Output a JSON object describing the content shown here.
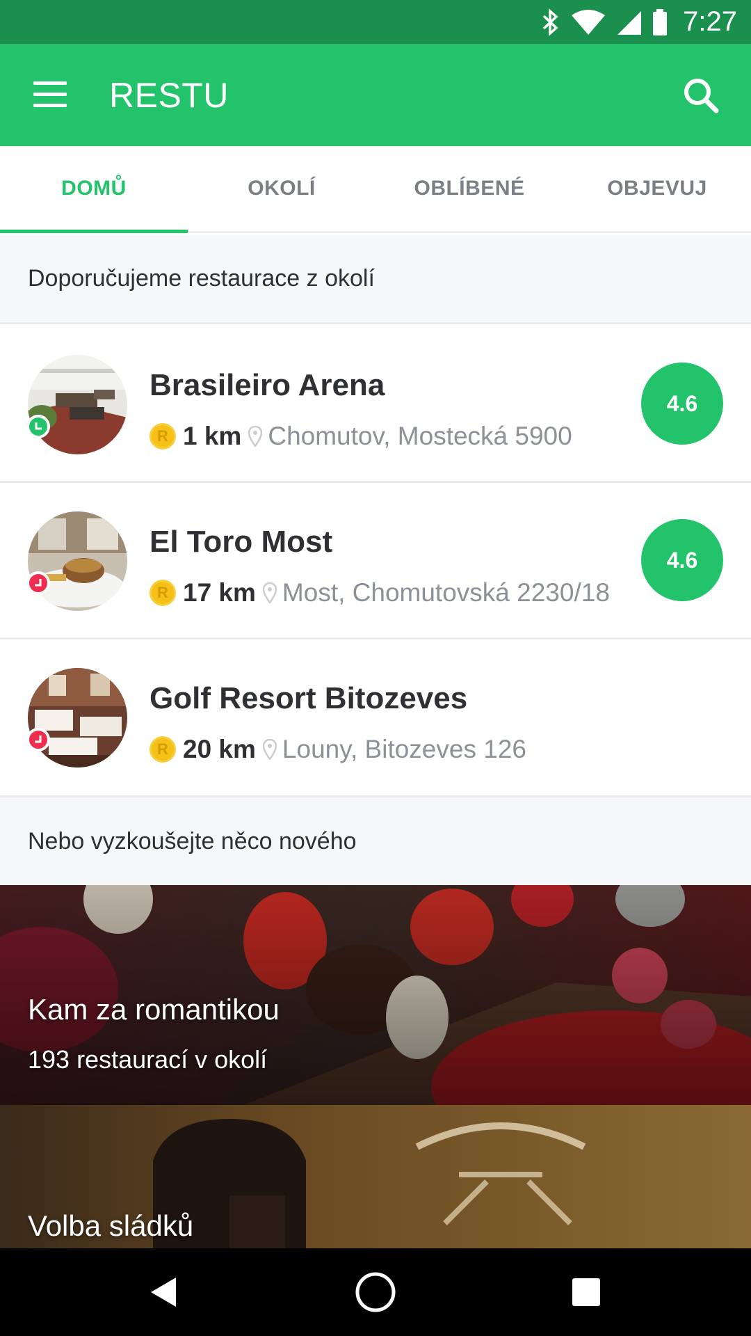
{
  "status_bar": {
    "time": "7:27"
  },
  "app_bar": {
    "title": "RESTU"
  },
  "tabs": [
    {
      "label": "DOMŮ",
      "active": true
    },
    {
      "label": "OKOLÍ",
      "active": false
    },
    {
      "label": "OBLÍBENÉ",
      "active": false
    },
    {
      "label": "OBJEVUJ",
      "active": false
    }
  ],
  "recommended": {
    "header": "Doporučujeme restaurace z okolí",
    "items": [
      {
        "name": "Brasileiro Arena",
        "distance": "1 km",
        "address": "Chomutov, Mostecká 5900",
        "rating": "4.6",
        "badge": "green"
      },
      {
        "name": "El Toro Most",
        "distance": "17 km",
        "address": "Most, Chomutovská 2230/18",
        "rating": "4.6",
        "badge": "red"
      },
      {
        "name": "Golf Resort Bitozeves",
        "distance": "20 km",
        "address": "Louny, Bitozeves 126",
        "rating": "",
        "badge": "red"
      }
    ]
  },
  "discover": {
    "header": "Nebo vyzkoušejte něco nového",
    "banners": [
      {
        "title": "Kam za romantikou",
        "subtitle": "193 restaurací v okolí"
      },
      {
        "title": "Volba sládků",
        "subtitle": ""
      }
    ]
  },
  "colors": {
    "brand": "#22c36a",
    "status_bar": "#1a8f4e",
    "badge_red": "#ee2d4f",
    "coin": "#f5c118"
  }
}
